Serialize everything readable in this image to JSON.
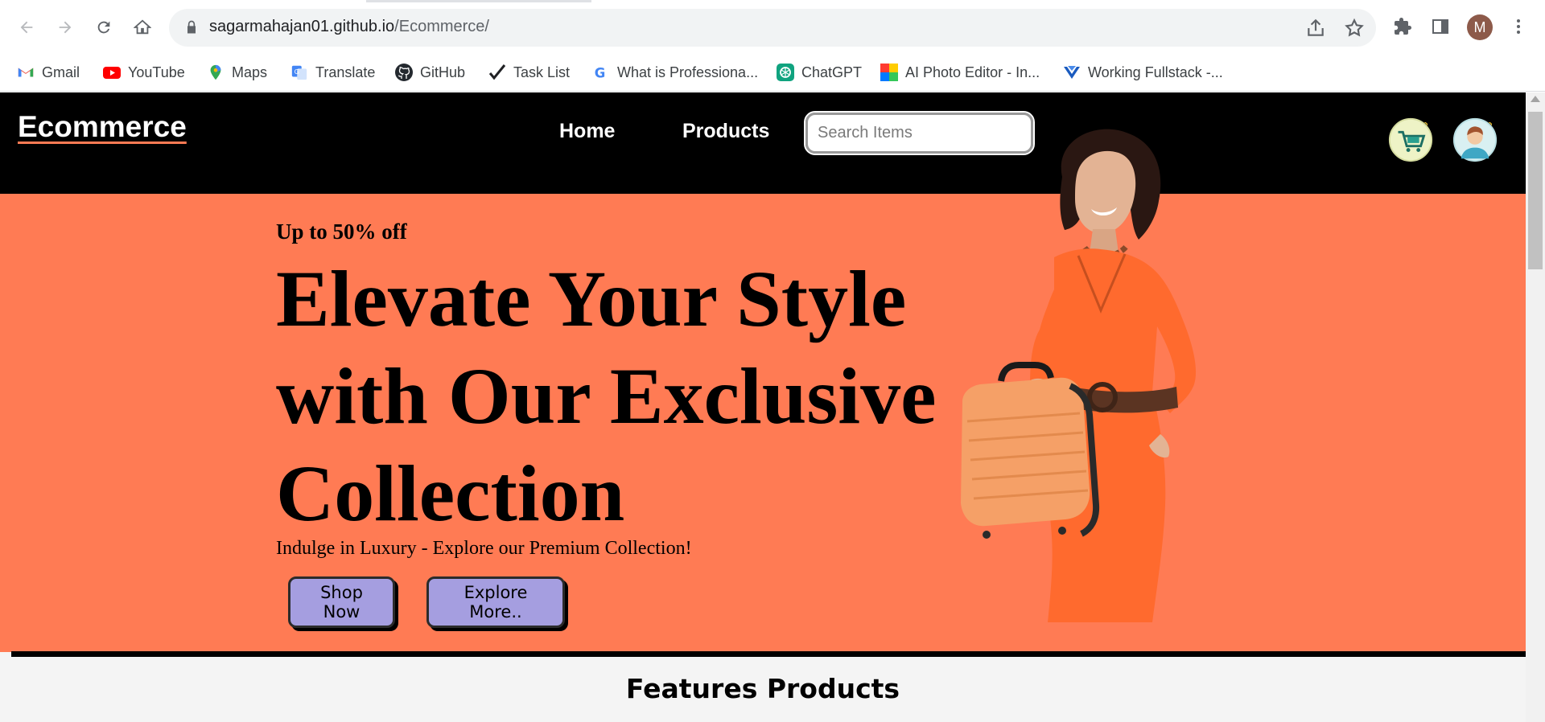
{
  "browser": {
    "url_host": "sagarmahajan01.github.io",
    "url_path": "/Ecommerce/",
    "profile_initial": "M",
    "bookmarks": [
      {
        "label": "Gmail",
        "icon": "gmail-icon"
      },
      {
        "label": "YouTube",
        "icon": "youtube-icon"
      },
      {
        "label": "Maps",
        "icon": "maps-icon"
      },
      {
        "label": "Translate",
        "icon": "translate-icon"
      },
      {
        "label": "GitHub",
        "icon": "github-icon"
      },
      {
        "label": "Task List",
        "icon": "checkmark-icon"
      },
      {
        "label": "What is Professiona...",
        "icon": "google-icon"
      },
      {
        "label": "ChatGPT",
        "icon": "chatgpt-icon"
      },
      {
        "label": "AI Photo Editor - In...",
        "icon": "photo-editor-icon"
      },
      {
        "label": "Working Fullstack -...",
        "icon": "fullstack-icon"
      }
    ]
  },
  "site": {
    "logo": "Ecommerce",
    "nav": {
      "home": "Home",
      "products": "Products"
    },
    "search_placeholder": "Search Items",
    "colors": {
      "header_bg": "#000000",
      "hero_bg": "#ff7b54",
      "button_bg": "#a59ee0"
    }
  },
  "hero": {
    "promo": "Up to 50% off",
    "title_line1": "Elevate Your Style",
    "title_line2": "with Our Exclusive",
    "title_line3": "Collection",
    "subtitle": "Indulge in Luxury - Explore our Premium Collection!",
    "cta_primary": "Shop Now",
    "cta_secondary": "Explore More.."
  },
  "features": {
    "title": "Features Products"
  }
}
